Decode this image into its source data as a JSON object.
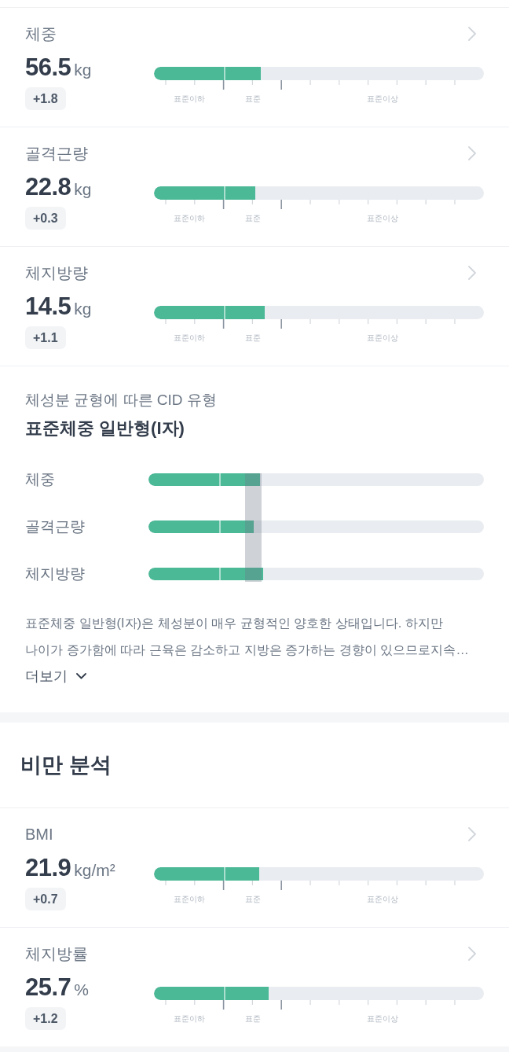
{
  "body_metrics": [
    {
      "label": "체중",
      "value": "56.5",
      "unit": "kg",
      "change": "+1.8",
      "level": 0.324,
      "scale_labels": [
        "표준이하",
        "표준",
        "표준이상"
      ]
    },
    {
      "label": "골격근량",
      "value": "22.8",
      "unit": "kg",
      "change": "+0.3",
      "level": 0.307,
      "scale_labels": [
        "표준이하",
        "표준",
        "표준이상"
      ]
    },
    {
      "label": "체지방량",
      "value": "14.5",
      "unit": "kg",
      "change": "+1.1",
      "level": 0.336,
      "scale_labels": [
        "표준이하",
        "표준",
        "표준이상"
      ]
    }
  ],
  "cid": {
    "subtitle": "체성분 균형에 따른 CID 유형",
    "title": "표준체중 일반형(I자)",
    "rows": [
      {
        "label": "체중",
        "level": 0.333
      },
      {
        "label": "골격근량",
        "level": 0.313
      },
      {
        "label": "체지방량",
        "level": 0.343
      }
    ],
    "description": "표준체중 일반형(I자)은 체성분이 매우 균형적인 양호한 상태입니다. 하지만 나이가 증가함에 따라 근육은 감소하고 지방은 증가하는 경향이 있으므로지속…",
    "more_button": "더보기"
  },
  "obesity": {
    "title": "비만 분석",
    "metrics": [
      {
        "label": "BMI",
        "value": "21.9",
        "unit": "kg/m²",
        "change": "+0.7",
        "level": 0.319,
        "scale_labels": [
          "표준이하",
          "표준",
          "표준이상"
        ]
      },
      {
        "label": "체지방률",
        "value": "25.7",
        "unit": "%",
        "change": "+1.2",
        "level": 0.348,
        "scale_labels": [
          "표준이하",
          "표준",
          "표준이상"
        ]
      }
    ]
  }
}
